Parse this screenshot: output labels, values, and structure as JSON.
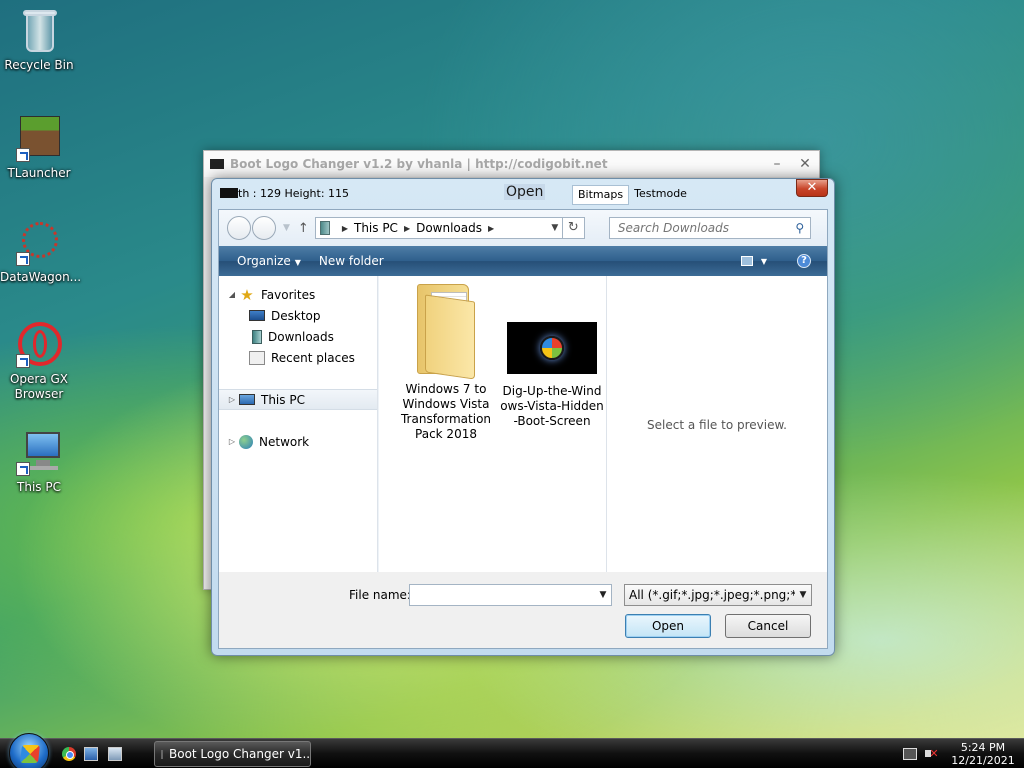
{
  "desktop": {
    "icons": [
      {
        "label": "Recycle Bin"
      },
      {
        "label": "TLauncher"
      },
      {
        "label": "DataWagon..."
      },
      {
        "label": "Opera GX\nBrowser"
      },
      {
        "label": "This PC"
      }
    ]
  },
  "app_window": {
    "title": "Boot Logo Changer v1.2 by vhanla | http://codigobit.net",
    "minimize": "–",
    "close": "✕"
  },
  "dialog": {
    "info": "th : 129 Height: 115",
    "caption": "Open",
    "tabs": [
      {
        "label": "Bitmaps"
      },
      {
        "label": "Testmode"
      }
    ],
    "close": "✕",
    "address": {
      "crumbs": [
        "This PC",
        "Downloads"
      ],
      "search_placeholder": "Search Downloads"
    },
    "toolbar": {
      "organize": "Organize",
      "new_folder": "New folder",
      "help": "?"
    },
    "nav": {
      "favorites": "Favorites",
      "desktop": "Desktop",
      "downloads": "Downloads",
      "recent": "Recent places",
      "this_pc": "This PC",
      "network": "Network"
    },
    "files": [
      {
        "name": "Windows 7 to Windows Vista Transformation Pack 2018"
      },
      {
        "name": "Dig-Up-the-Windows-Vista-Hidden-Boot-Screen"
      }
    ],
    "preview_text": "Select a file to preview.",
    "filename_label": "File name:",
    "filename_value": "",
    "filetype": "All (*.gif;*.jpg;*.jpeg;*.png;*.bmp)",
    "open_label": "Open",
    "cancel_label": "Cancel"
  },
  "taskbar": {
    "task_label": "Boot Logo Changer v1....",
    "time": "5:24 PM",
    "date": "12/21/2021"
  }
}
